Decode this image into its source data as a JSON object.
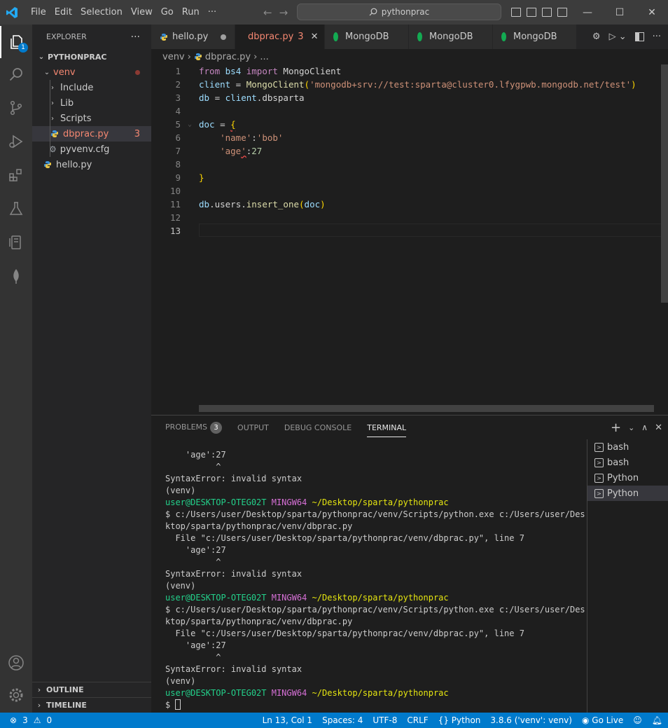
{
  "menu": [
    "File",
    "Edit",
    "Selection",
    "View",
    "Go",
    "Run",
    "···"
  ],
  "search": {
    "text": "pythonprac"
  },
  "activity": {
    "explorer_badge": "1"
  },
  "sidebar": {
    "title": "EXPLORER",
    "more": "···",
    "root": "PYTHONPRAC",
    "items": [
      {
        "label": "venv",
        "type": "folder-open"
      },
      {
        "label": "Include",
        "type": "folder"
      },
      {
        "label": "Lib",
        "type": "folder"
      },
      {
        "label": "Scripts",
        "type": "folder"
      },
      {
        "label": "dbprac.py",
        "type": "python",
        "errors": "3"
      },
      {
        "label": "pyvenv.cfg",
        "type": "config"
      },
      {
        "label": "hello.py",
        "type": "python"
      }
    ],
    "outline": "OUTLINE",
    "timeline": "TIMELINE"
  },
  "tabs": [
    {
      "label": "hello.py",
      "state": "dirty"
    },
    {
      "label": "dbprac.py",
      "errors": "3",
      "active": true
    },
    {
      "label": "MongoDB"
    },
    {
      "label": "MongoDB"
    },
    {
      "label": "MongoDB"
    }
  ],
  "breadcrumb": {
    "folder": "venv",
    "file": "dbprac.py",
    "more": "..."
  },
  "editor": {
    "line_numbers": [
      "1",
      "2",
      "3",
      "4",
      "5",
      "6",
      "7",
      "8",
      "9",
      "10",
      "11",
      "12",
      "13"
    ],
    "lines": [
      "from bs4 import MongoClient",
      "client = MongoClient('mongodb+srv://test:sparta@cluster0.lfygpwb.mongodb.net/test')",
      "db = client.dbsparta",
      "",
      "doc = {",
      "    'name':'bob'",
      "    'age':27",
      "",
      "}",
      "",
      "db.users.insert_one(doc)",
      "",
      ""
    ]
  },
  "panel": {
    "tabs": {
      "problems": "PROBLEMS",
      "problems_count": "3",
      "output": "OUTPUT",
      "debug": "DEBUG CONSOLE",
      "terminal": "TERMINAL"
    },
    "terminal_lines": [
      "    'age':27",
      "          ^",
      "SyntaxError: invalid syntax",
      "(venv)",
      "",
      "$ c:/Users/user/Desktop/sparta/pythonprac/venv/Scripts/python.exe c:/Users/user/Des",
      "ktop/sparta/pythonprac/venv/dbprac.py",
      "  File \"c:/Users/user/Desktop/sparta/pythonprac/venv/dbprac.py\", line 7",
      "    'age':27",
      "          ^",
      "SyntaxError: invalid syntax",
      "(venv)",
      "",
      "$ c:/Users/user/Desktop/sparta/pythonprac/venv/Scripts/python.exe c:/Users/user/Des",
      "ktop/sparta/pythonprac/venv/dbprac.py",
      "  File \"c:/Users/user/Desktop/sparta/pythonprac/venv/dbprac.py\", line 7",
      "    'age':27",
      "          ^",
      "SyntaxError: invalid syntax",
      "(venv)",
      "",
      "$ "
    ],
    "prompt": {
      "user": "user@DESKTOP-OTEG02T",
      "host": "MINGW64",
      "path": "~/Desktop/sparta/pythonprac"
    },
    "terminals": [
      "bash",
      "bash",
      "Python",
      "Python"
    ]
  },
  "status": {
    "errors": "3",
    "warnings": "0",
    "position": "Ln 13, Col 1",
    "spaces": "Spaces: 4",
    "encoding": "UTF-8",
    "eol": "CRLF",
    "language": "Python",
    "interpreter": "3.8.6 ('venv': venv)",
    "golive": "Go Live"
  }
}
